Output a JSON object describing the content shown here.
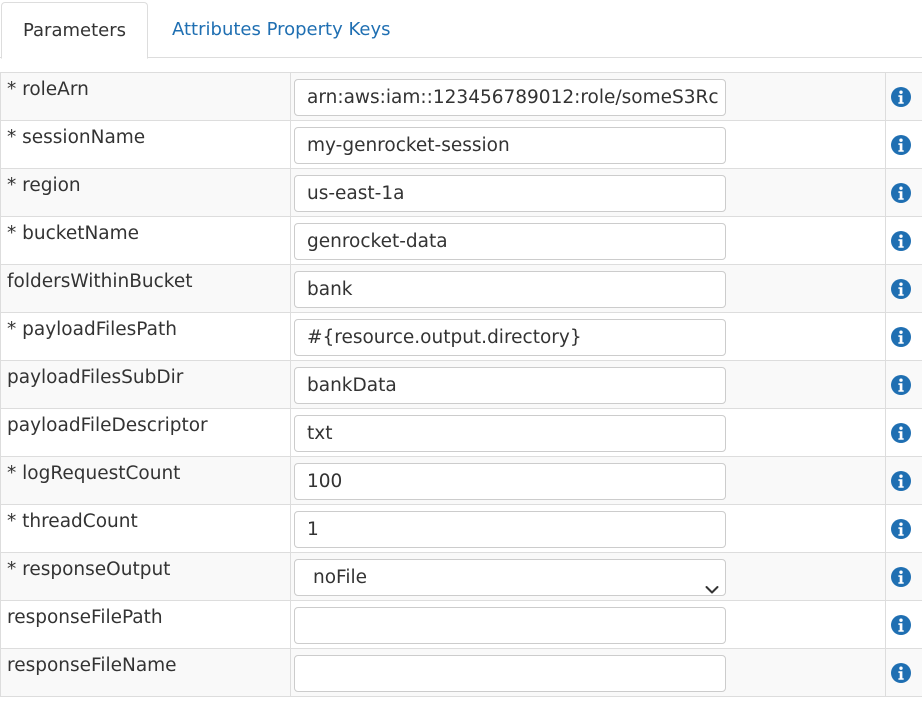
{
  "tabs": [
    {
      "label": "Parameters",
      "active": true
    },
    {
      "label": "Attributes Property Keys",
      "active": false
    }
  ],
  "rows": [
    {
      "label": "* roleArn",
      "value": "arn:aws:iam::123456789012:role/someS3Rc"
    },
    {
      "label": "* sessionName",
      "value": "my-genrocket-session"
    },
    {
      "label": "* region",
      "value": "us-east-1a"
    },
    {
      "label": "* bucketName",
      "value": "genrocket-data"
    },
    {
      "label": "foldersWithinBucket",
      "value": "bank"
    },
    {
      "label": "* payloadFilesPath",
      "value": "#{resource.output.directory}"
    },
    {
      "label": "payloadFilesSubDir",
      "value": "bankData"
    },
    {
      "label": "payloadFileDescriptor",
      "value": "txt"
    },
    {
      "label": "* logRequestCount",
      "value": "100"
    },
    {
      "label": "* threadCount",
      "value": "1"
    },
    {
      "label": "* responseOutput",
      "value": "noFile",
      "type": "select"
    },
    {
      "label": "responseFilePath",
      "value": ""
    },
    {
      "label": "responseFileName",
      "value": ""
    }
  ],
  "icons": {
    "info": "info-circle-icon",
    "chevron": "chevron-down-icon"
  },
  "colors": {
    "accent": "#1f6fb2",
    "border": "#dddddd",
    "stripe": "#f9f9f9"
  }
}
